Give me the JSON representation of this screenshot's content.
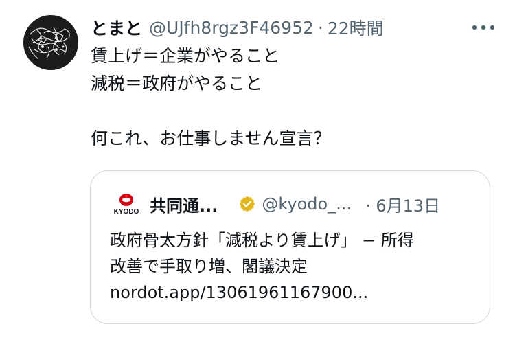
{
  "tweet": {
    "display_name": "とまと",
    "handle": "@UJfh8rgz3F46952",
    "separator": "·",
    "time": "22時間",
    "more_icon": "ellipsis-icon",
    "body_lines": [
      "賃上げ＝企業がやること",
      "減税＝政府がやること",
      "",
      "何これ、お仕事しません宣言？"
    ]
  },
  "quote": {
    "logo_text": "KYODO",
    "display_name": "共同通...",
    "verified_icon": "verified-badge-icon",
    "handle": "@kyodo_...",
    "time": "· 6月13日",
    "body_lines": [
      "政府骨太方針「減税より賃上げ」 − 所得",
      "改善で手取り増、閣議決定",
      "nordot.app/13061961167900..."
    ]
  },
  "colors": {
    "text": "#0f1419",
    "secondary": "#536471",
    "border": "#cfd9de",
    "verified_gold": "#e2b719",
    "kyodo_red": "#d7000f"
  }
}
